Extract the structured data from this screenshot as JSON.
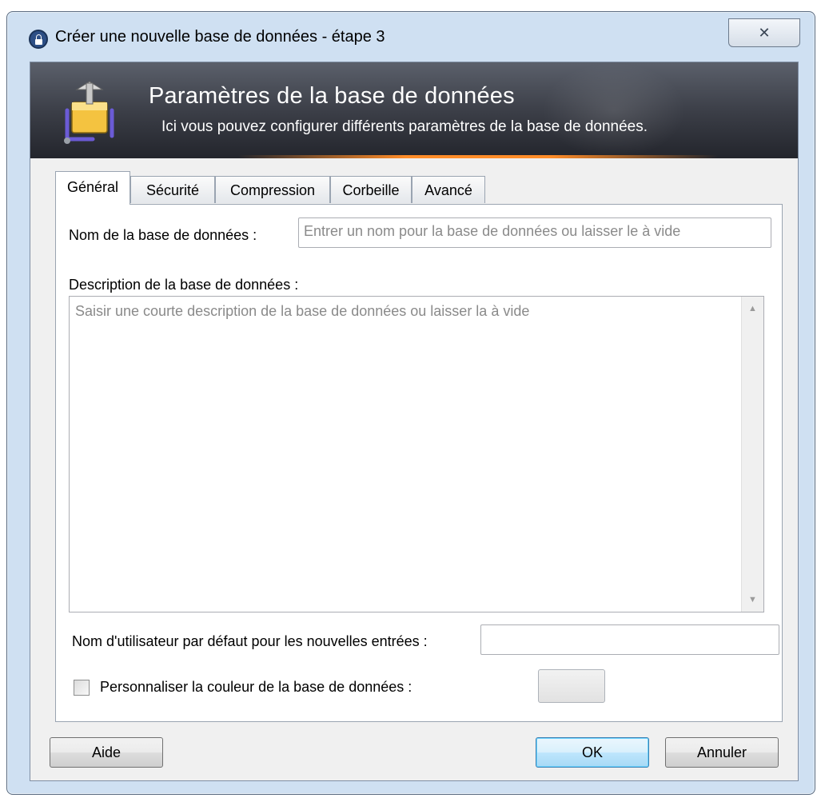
{
  "window": {
    "title": "Créer une nouvelle base de données - étape 3",
    "close_glyph": "✕"
  },
  "banner": {
    "title": "Paramètres de la base de données",
    "subtitle": "Ici vous pouvez configurer différents paramètres de la base de données."
  },
  "tabs": [
    {
      "label": "Général",
      "active": true
    },
    {
      "label": "Sécurité",
      "active": false
    },
    {
      "label": "Compression",
      "active": false
    },
    {
      "label": "Corbeille",
      "active": false
    },
    {
      "label": "Avancé",
      "active": false
    }
  ],
  "general": {
    "db_name_label": "Nom de la base de données :",
    "db_name_value": "",
    "db_name_placeholder": "Entrer un nom pour la base de données ou laisser le à vide",
    "description_label": "Description de la base de données :",
    "description_placeholder": "Saisir une courte description de la base de données ou laisser la à vide",
    "default_user_label": "Nom d'utilisateur par défaut pour les nouvelles entrées :",
    "default_user_value": "",
    "custom_color_label": "Personnaliser la couleur de la base de données :",
    "custom_color_checked": false
  },
  "buttons": {
    "help": "Aide",
    "ok": "OK",
    "cancel": "Annuler"
  },
  "colors": {
    "banner_accent": "#ff8c28",
    "default_button_border": "#3c7fb1"
  }
}
